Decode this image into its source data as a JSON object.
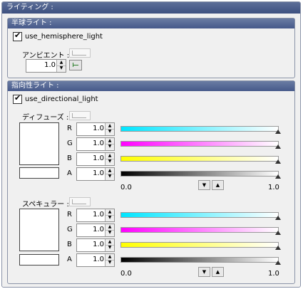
{
  "panel": {
    "title": "ライティング :"
  },
  "hemisphere": {
    "title": "半球ライト :",
    "checkbox_label": "use_hemisphere_light",
    "ambient_label": "アンビエント :",
    "ambient_value": "1.0"
  },
  "directional": {
    "title": "指向性ライト :",
    "checkbox_label": "use_directional_light",
    "diffuse": {
      "label": "ディフューズ :",
      "channels": [
        {
          "name": "R",
          "value": "1.0",
          "color": "#00e5ff"
        },
        {
          "name": "G",
          "value": "1.0",
          "color": "#ff00ff"
        },
        {
          "name": "B",
          "value": "1.0",
          "color": "#ffff00"
        },
        {
          "name": "A",
          "value": "1.0",
          "color": "#000000"
        }
      ],
      "scale_min": "0.0",
      "scale_max": "1.0"
    },
    "specular": {
      "label": "スペキュラー :",
      "channels": [
        {
          "name": "R",
          "value": "1.0",
          "color": "#00e5ff"
        },
        {
          "name": "G",
          "value": "1.0",
          "color": "#ff00ff"
        },
        {
          "name": "B",
          "value": "1.0",
          "color": "#ffff00"
        },
        {
          "name": "A",
          "value": "1.0",
          "color": "#000000"
        }
      ],
      "scale_min": "0.0",
      "scale_max": "1.0"
    }
  }
}
